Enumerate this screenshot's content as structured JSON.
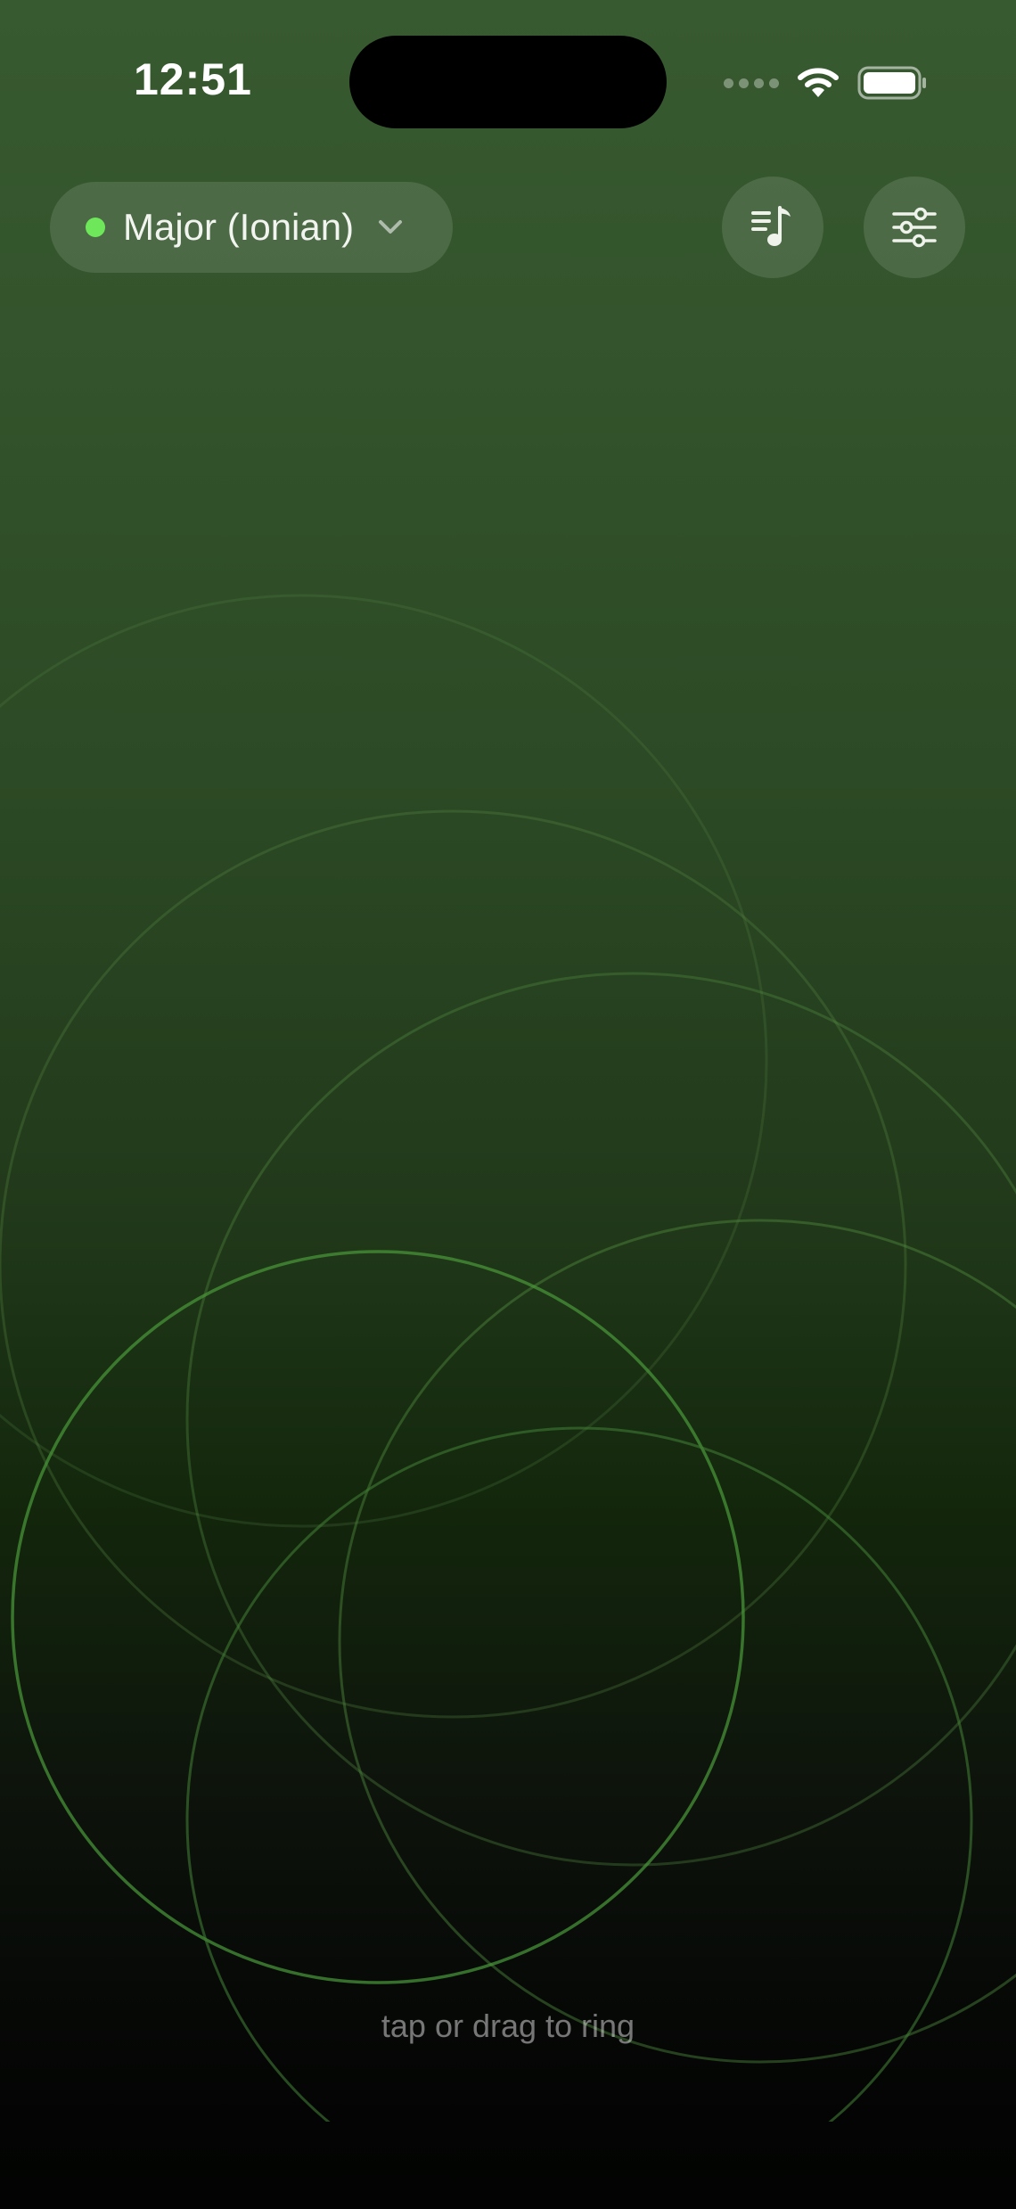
{
  "status_bar": {
    "time": "12:51"
  },
  "toolbar": {
    "mode_label": "Major (Ionian)",
    "mode_indicator_color": "#6ee85a",
    "playlist_icon": "music-note-list-icon",
    "settings_icon": "sliders-icon"
  },
  "hint": {
    "text": "tap or drag to ring"
  },
  "colors": {
    "background_top": "#385a30",
    "background_bottom": "#020302",
    "ring_stroke": "#4f8a3f"
  }
}
